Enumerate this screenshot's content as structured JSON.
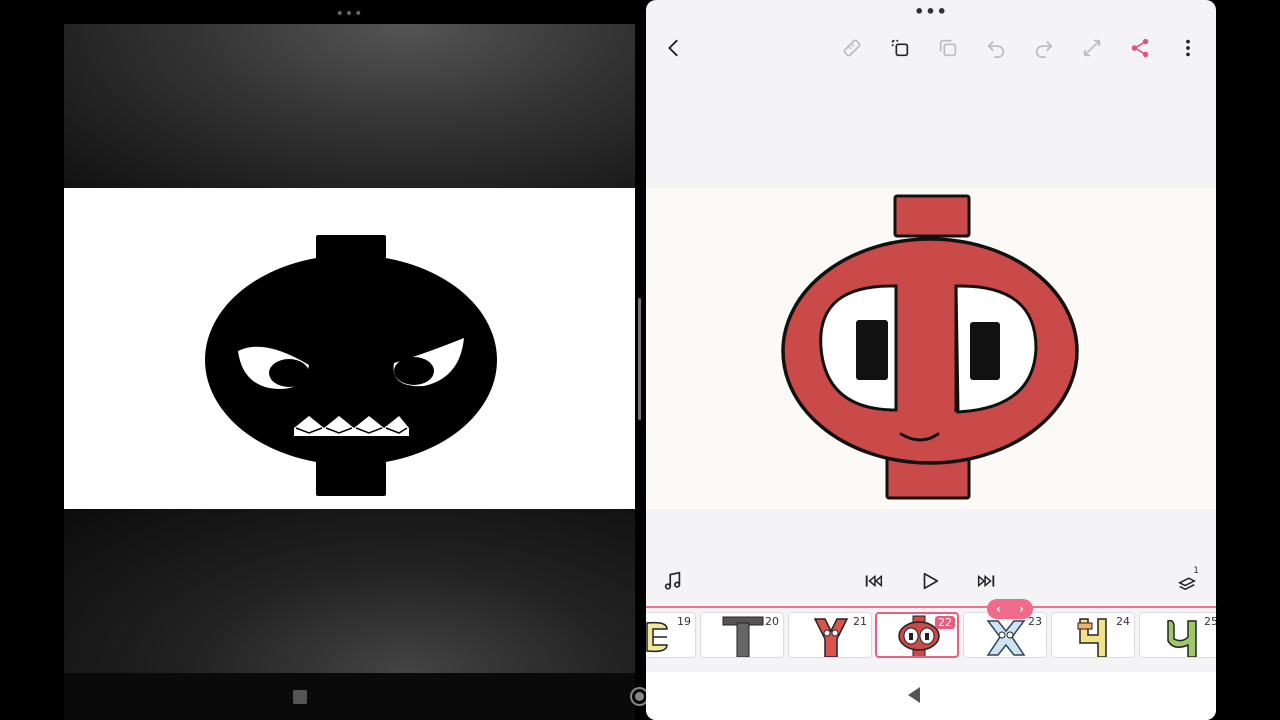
{
  "app": {
    "toolbar": {
      "back": "back-icon",
      "ruler": "ruler-icon",
      "copy_frame": "copy-frame-icon",
      "duplicate": "duplicate-icon",
      "undo": "undo-icon",
      "redo": "redo-icon",
      "resize": "resize-icon",
      "share": "share-icon",
      "more": "more-vertical-icon"
    },
    "controls": {
      "music": "music-icon",
      "rewind": "skip-back-icon",
      "play": "play-icon",
      "forward": "skip-forward-icon",
      "layers": "layers-icon",
      "layer_count": "1"
    },
    "timeline": {
      "active_frame": "22",
      "frames": [
        {
          "num": "19"
        },
        {
          "num": "20"
        },
        {
          "num": "21"
        },
        {
          "num": "22"
        },
        {
          "num": "23"
        },
        {
          "num": "24"
        },
        {
          "num": "25"
        }
      ]
    }
  },
  "colors": {
    "accent": "#ec5a7c",
    "character_red": "#c94a48",
    "share_pink": "#e8507a"
  }
}
